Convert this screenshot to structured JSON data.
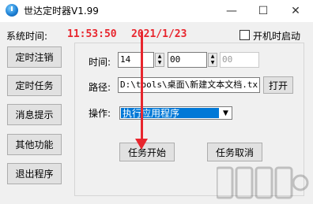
{
  "window": {
    "title": "世达定时器V1.99",
    "controls": {
      "minimize": "—",
      "maximize": "☐",
      "close": "✕"
    }
  },
  "header": {
    "system_time_label": "系统时间:",
    "time_value": "11:53:50",
    "date_value": "2021/1/23",
    "startup_label": "开机时启动",
    "startup_checked": false
  },
  "sidebar": {
    "buttons": [
      {
        "label": "定时注销"
      },
      {
        "label": "定时任务"
      },
      {
        "label": "消息提示"
      },
      {
        "label": "其他功能"
      },
      {
        "label": "退出程序"
      }
    ]
  },
  "task": {
    "time_label": "时间:",
    "hour": "14",
    "minute": "00",
    "second": "00",
    "path_label": "路径:",
    "path_value": "D:\\tools\\桌面\\新建文本文档.tx",
    "open_label": "打开",
    "action_label": "操作:",
    "action_value": "执行应用程序",
    "start_label": "任务开始",
    "cancel_label": "任务取消"
  },
  "colors": {
    "clock": "#e8262e",
    "arrow": "#e8262e",
    "selection": "#0078d7"
  }
}
